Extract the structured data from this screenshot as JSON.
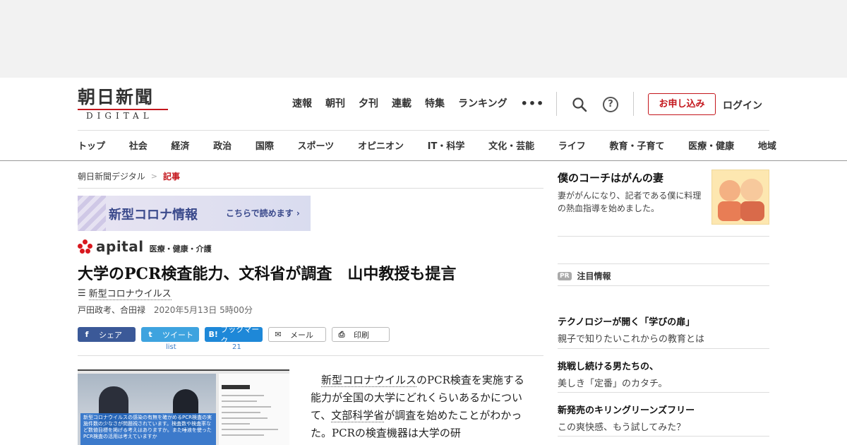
{
  "logo": {
    "jp": "朝日新聞",
    "en": "DIGITAL"
  },
  "topnav": [
    "速報",
    "朝刊",
    "夕刊",
    "連載",
    "特集",
    "ランキング"
  ],
  "more_label": "•••",
  "help_label": "?",
  "subscribe_label": "お申し込み",
  "login_label": "ログイン",
  "categories": [
    "トップ",
    "社会",
    "経済",
    "政治",
    "国際",
    "スポーツ",
    "オピニオン",
    "IT・科学",
    "文化・芸能",
    "ライフ",
    "教育・子育て",
    "医療・健康",
    "地域"
  ],
  "breadcrumb": {
    "home": "朝日新聞デジタル",
    "sep": ">",
    "current": "記事"
  },
  "corona_banner": {
    "main": "新型コロナ情報",
    "sub": "こちらで読めます ›"
  },
  "apital": {
    "name": "apital",
    "category": "医療・健康・介護"
  },
  "headline": "大学のPCR検査能力、文科省が調査　山中教授も提言",
  "topic": {
    "icon": "list-icon",
    "label": "新型コロナウイルス"
  },
  "byline": {
    "authors": "戸田政考、合田禄",
    "date": "2020年5月13日 5時00分"
  },
  "share": {
    "facebook": {
      "icon": "f",
      "label": "シェア"
    },
    "twitter": {
      "icon": "t",
      "label": "ツイート",
      "count": "list"
    },
    "hatena": {
      "icon": "B!",
      "label": "ブックマーク",
      "count": "21"
    },
    "mail": {
      "icon": "✉",
      "label": "メール"
    },
    "print": {
      "icon": "⎙",
      "label": "印刷"
    }
  },
  "video_caption": "新型コロナウイルスの感染の有無を確かめるPCR検査の実施件数の少なさが問題視されています。検査数や検査率など数値目標を掲げる考えはありますか。また唾液を使ったPCR検査の活用は考えていますか",
  "body": {
    "seg1": "新型コロナウイルス",
    "seg2": "のPCR検査を実施する能力が全国の大学にどれくらいあるかについて、",
    "seg3": "文部科学省",
    "seg4": "が調査を始めたことがわかった。PCRの検査機器は大学の研"
  },
  "sidebar": {
    "feature": {
      "title": "僕のコーチはがんの妻",
      "desc": "妻ががんになり、記者である僕に料理の熱血指導を始めました。"
    },
    "pr_badge": "PR",
    "pr_title": "注目情報",
    "items": [
      {
        "headline": "テクノロジーが開く「学びの扉」",
        "desc": "親子で知りたいこれからの教育とは"
      },
      {
        "headline": "挑戦し続ける男たちの、",
        "desc": "美しき「定番」のカタチ。"
      },
      {
        "headline": "新発売のキリングリーンズフリー",
        "desc": "この爽快感、もう試してみた？"
      }
    ]
  }
}
